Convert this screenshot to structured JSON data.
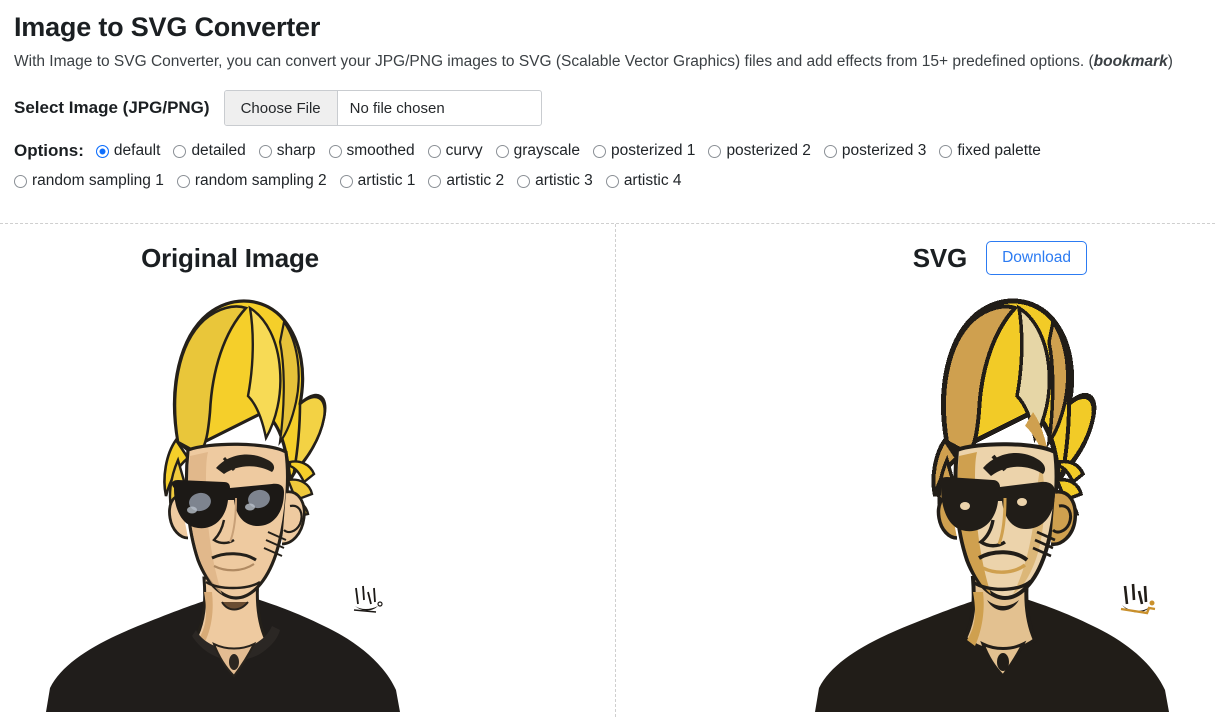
{
  "header": {
    "title": "Image to SVG Converter",
    "description_before": "With Image to SVG Converter, you can convert your JPG/PNG images to SVG (Scalable Vector Graphics) files and add effects from 15+ predefined options. (",
    "description_link": "bookmark",
    "description_after": ")"
  },
  "file_select": {
    "label": "Select Image (JPG/PNG)",
    "button_label": "Choose File",
    "file_name": "No file chosen"
  },
  "options": {
    "label": "Options:",
    "selected": "default",
    "row1": [
      {
        "label": "default",
        "checked": true
      },
      {
        "label": "detailed",
        "checked": false
      },
      {
        "label": "sharp",
        "checked": false
      },
      {
        "label": "smoothed",
        "checked": false
      },
      {
        "label": "curvy",
        "checked": false
      },
      {
        "label": "grayscale",
        "checked": false
      },
      {
        "label": "posterized 1",
        "checked": false
      },
      {
        "label": "posterized 2",
        "checked": false
      },
      {
        "label": "posterized 3",
        "checked": false
      },
      {
        "label": "fixed palette",
        "checked": false
      }
    ],
    "row2": [
      {
        "label": "random sampling 1",
        "checked": false
      },
      {
        "label": "random sampling 2",
        "checked": false
      },
      {
        "label": "artistic 1",
        "checked": false
      },
      {
        "label": "artistic 2",
        "checked": false
      },
      {
        "label": "artistic 3",
        "checked": false
      },
      {
        "label": "artistic 4",
        "checked": false
      }
    ]
  },
  "panels": {
    "left": {
      "title": "Original Image",
      "artwork_name": "cartoon-portrait-blond-pompadour-sunglasses"
    },
    "right": {
      "title": "SVG",
      "download_label": "Download",
      "artwork_name": "cartoon-portrait-blond-pompadour-sunglasses-posterized"
    }
  },
  "colors": {
    "accent_blue": "#0d6efd",
    "link_blue": "#2c7bf2",
    "divider": "#cfcfcf",
    "hair_yellow": "#f5cf2a",
    "hair_shadow": "#cfa04f",
    "skin": "#eecaa0",
    "skin_shadow": "#c79a63",
    "ink": "#211d18",
    "shirt": "#201d1b"
  }
}
